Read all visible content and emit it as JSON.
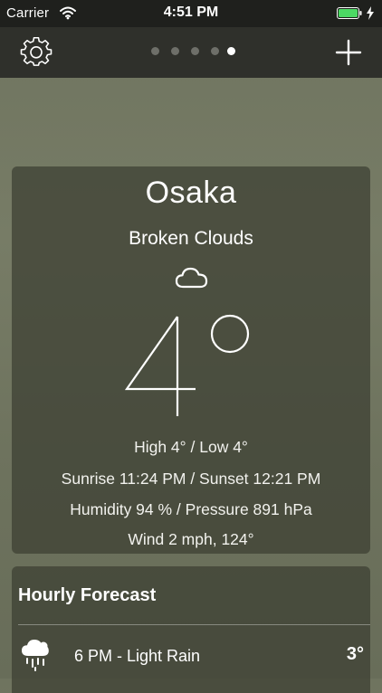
{
  "status_bar": {
    "carrier": "Carrier",
    "time": "4:51 PM",
    "battery_color": "#4cd964"
  },
  "nav": {
    "page_count": 5,
    "active_page": 5
  },
  "weather": {
    "city": "Osaka",
    "condition": "Broken Clouds",
    "condition_icon": "cloud-icon",
    "temperature": "4°",
    "high_low": "High 4° / Low 4°",
    "sun": "Sunrise 11:24 PM / Sunset 12:21 PM",
    "humidity_pressure": "Humidity 94 % / Pressure 891 hPa",
    "wind": "Wind 2 mph, 124°"
  },
  "hourly": {
    "title": "Hourly Forecast",
    "items": [
      {
        "icon": "rain-cloud-icon",
        "label": "6 PM - Light Rain",
        "temp": "3°"
      }
    ]
  }
}
